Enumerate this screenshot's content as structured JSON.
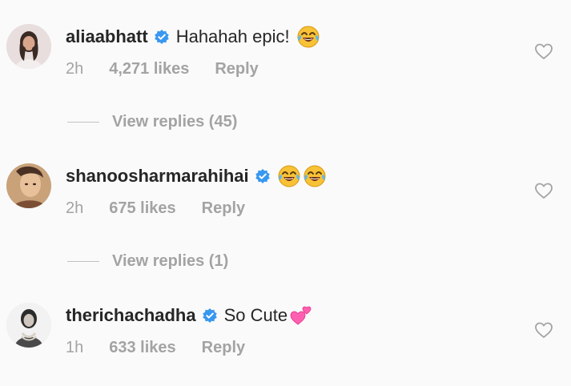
{
  "comments": [
    {
      "username": "aliaabhatt",
      "verified": true,
      "text": "Hahahah epic!",
      "emojis": [
        "tears-of-joy"
      ],
      "time": "2h",
      "likes": "4,271 likes",
      "reply": "Reply",
      "view_replies": "View replies (45)"
    },
    {
      "username": "shanoosharmarahihai",
      "verified": true,
      "text": "",
      "emojis": [
        "tears-of-joy",
        "tears-of-joy"
      ],
      "time": "2h",
      "likes": "675 likes",
      "reply": "Reply",
      "view_replies": "View replies (1)"
    },
    {
      "username": "therichachadha",
      "verified": true,
      "text": "So Cute",
      "emojis": [
        "two-hearts"
      ],
      "time": "1h",
      "likes": "633 likes",
      "reply": "Reply"
    }
  ],
  "colors": {
    "background": "#fafafa",
    "text": "#262626",
    "muted": "#a3a3a3",
    "verified": "#3897f0",
    "heart_outline": "#a3a3a3"
  }
}
